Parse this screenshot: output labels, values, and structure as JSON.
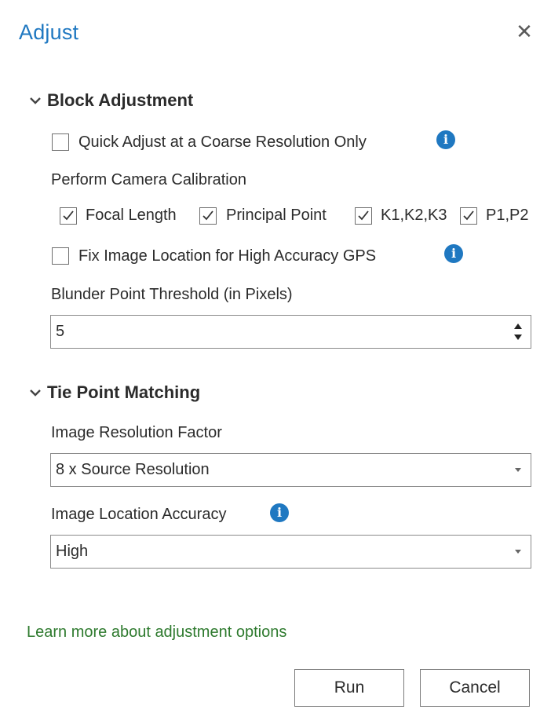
{
  "dialog": {
    "title": "Adjust"
  },
  "block_adjustment": {
    "heading": "Block Adjustment",
    "quick_adjust_label": "Quick Adjust at a Coarse Resolution Only",
    "quick_adjust_checked": false,
    "camera_calibration_label": "Perform Camera Calibration",
    "calibration_options": [
      {
        "label": "Focal Length",
        "checked": true
      },
      {
        "label": "Principal Point",
        "checked": true
      },
      {
        "label": "K1,K2,K3",
        "checked": true
      },
      {
        "label": "P1,P2",
        "checked": true
      }
    ],
    "fix_location_label": "Fix Image Location for High Accuracy GPS",
    "fix_location_checked": false,
    "blunder_label": "Blunder Point Threshold (in Pixels)",
    "blunder_value": "5"
  },
  "tie_point_matching": {
    "heading": "Tie Point Matching",
    "resolution_factor_label": "Image Resolution Factor",
    "resolution_factor_value": "8 x Source Resolution",
    "location_accuracy_label": "Image Location Accuracy",
    "location_accuracy_value": "High"
  },
  "footer": {
    "learn_more_link": "Learn more about adjustment options",
    "run_label": "Run",
    "cancel_label": "Cancel"
  },
  "colors": {
    "accent": "#1f78c1",
    "link": "#2e7a2e"
  },
  "icons": {
    "close": "close-icon",
    "info": "info-icon",
    "collapse": "chevron-down-icon"
  }
}
